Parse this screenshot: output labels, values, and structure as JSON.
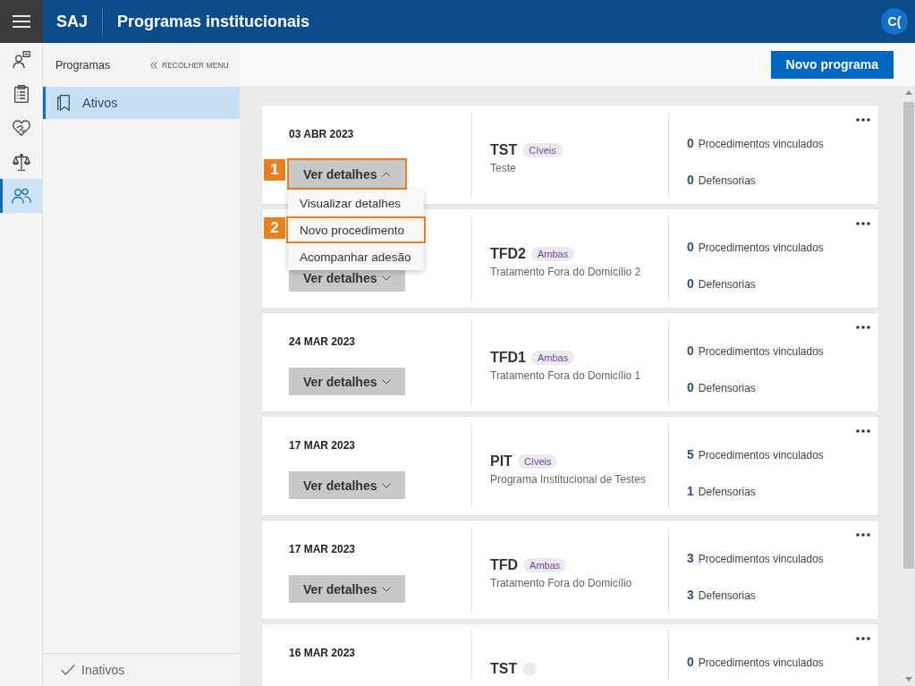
{
  "app_bar": {
    "brand": "SAJ",
    "title": "Programas institucionais",
    "avatar": "C("
  },
  "nav_rail": [
    {
      "selected": false
    },
    {
      "selected": false
    },
    {
      "selected": false
    },
    {
      "selected": false
    },
    {
      "selected": true
    }
  ],
  "sidebar": {
    "title": "Programas",
    "collapse_link": "RECOLHER MENU",
    "items": [
      {
        "label": "Ativos",
        "selected": true
      }
    ],
    "footer_link": "Inativos"
  },
  "toolbar": {
    "primary_button": "Novo programa"
  },
  "programs": [
    {
      "date": "03 ABR 2023",
      "details_button": {
        "label": "Ver detalhes",
        "expanded": true,
        "callout": "1"
      },
      "menu": [
        {
          "label": "Visualizar detalhes"
        },
        {
          "label": "Novo procedimento",
          "callout": "2"
        },
        {
          "label": "Acompanhar adesão"
        }
      ],
      "code": "TST",
      "tag": "Cíveis",
      "description": "Teste",
      "procedures_count": "0",
      "procedures_label": "Procedimentos vinculados",
      "offices_count": "0",
      "offices_label": "Defensorias"
    },
    {
      "details_button": {
        "label": "Ver detalhes",
        "expanded": false
      },
      "code": "TFD2",
      "tag": "Ambas",
      "description": "Tratamento Fora do Domicílio 2",
      "procedures_count": "0",
      "procedures_label": "Procedimentos vinculados",
      "offices_count": "0",
      "offices_label": "Defensorias"
    },
    {
      "date": "24 MAR 2023",
      "details_button": {
        "label": "Ver detalhes",
        "expanded": false
      },
      "code": "TFD1",
      "tag": "Ambas",
      "description": "Tratamento Fora do Domicílio 1",
      "procedures_count": "0",
      "procedures_label": "Procedimentos vinculados",
      "offices_count": "0",
      "offices_label": "Defensorias"
    },
    {
      "date": "17 MAR 2023",
      "details_button": {
        "label": "Ver detalhes",
        "expanded": false
      },
      "code": "PIT",
      "tag": "Cíveis",
      "description": "Programa Institucional de Testes",
      "procedures_count": "5",
      "procedures_label": "Procedimentos vinculados",
      "offices_count": "1",
      "offices_label": "Defensorias"
    },
    {
      "date": "17 MAR 2023",
      "details_button": {
        "label": "Ver detalhes",
        "expanded": false
      },
      "code": "TFD",
      "tag": "Ambas",
      "description": "Tratamento Fora do Domicílio",
      "procedures_count": "3",
      "procedures_label": "Procedimentos vinculados",
      "offices_count": "3",
      "offices_label": "Defensorias"
    },
    {
      "date": "16 MAR 2023",
      "code": "TST",
      "empty_tag": true,
      "procedures_count": "0",
      "procedures_label": "Procedimentos vinculados"
    }
  ]
}
